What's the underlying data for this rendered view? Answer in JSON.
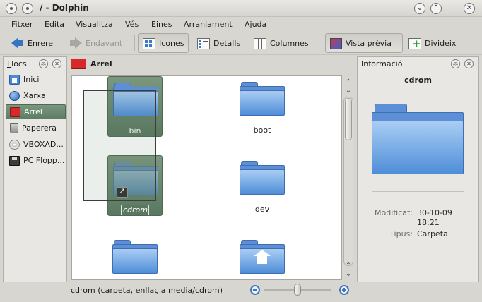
{
  "window": {
    "title": "/ - Dolphin",
    "buttons": {
      "minimize": "⌄",
      "maximize": "⌃",
      "close": "✕"
    }
  },
  "menubar": {
    "items": [
      "Fitxer",
      "Edita",
      "Visualitza",
      "Vés",
      "Eines",
      "Arranjament",
      "Ajuda"
    ]
  },
  "toolbar": {
    "back": "Enrere",
    "forward": "Endavant",
    "icons_view": "Icones",
    "details_view": "Detalls",
    "columns_view": "Columnes",
    "preview": "Vista prèvia",
    "split": "Divideix"
  },
  "places": {
    "title": "Llocs",
    "items": [
      {
        "label": "Inici",
        "icon": "home-icon"
      },
      {
        "label": "Xarxa",
        "icon": "network-icon"
      },
      {
        "label": "Arrel",
        "icon": "folder-red-icon",
        "selected": true
      },
      {
        "label": "Paperera",
        "icon": "trash-icon"
      },
      {
        "label": "VBOXAD...",
        "icon": "cdrom-icon"
      },
      {
        "label": "PC Flopp...",
        "icon": "floppy-icon"
      }
    ]
  },
  "breadcrumb": {
    "current": "Arrel"
  },
  "files": [
    {
      "name": "bin",
      "selected": true
    },
    {
      "name": "boot"
    },
    {
      "name": "cdrom",
      "selected": true,
      "editing": true,
      "link": true
    },
    {
      "name": "dev"
    },
    {
      "name": ""
    },
    {
      "name": ""
    }
  ],
  "status": {
    "text": "cdrom (carpeta, enllaç a media/cdrom)",
    "zoom_level": 0.5
  },
  "info": {
    "title": "Informació",
    "name": "cdrom",
    "modified_label": "Modificat:",
    "modified_value": "30-10-09",
    "modified_time": "18:21",
    "type_label": "Tipus:",
    "type_value": "Carpeta"
  },
  "colors": {
    "selection": "#5f7d65",
    "folder_blue": "#4f8ed8",
    "root_folder_red": "#d62a2a"
  }
}
